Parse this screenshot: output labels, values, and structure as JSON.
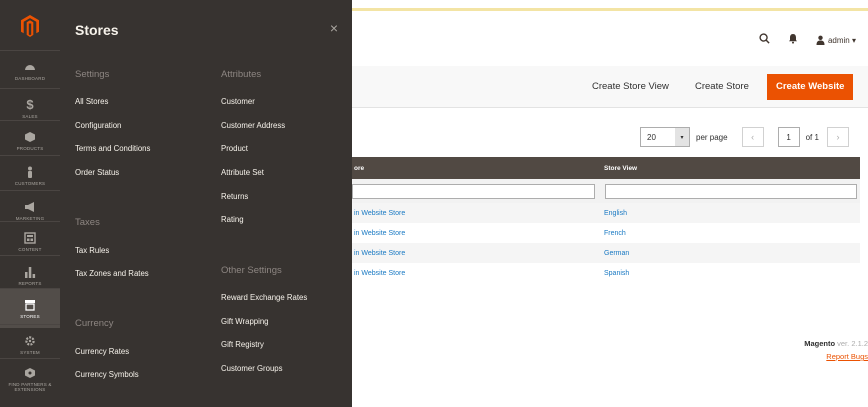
{
  "sidebar": {
    "items": [
      {
        "label": "DASHBOARD",
        "icon": "dashboard-icon"
      },
      {
        "label": "SALES",
        "icon": "dollar-icon"
      },
      {
        "label": "PRODUCTS",
        "icon": "cube-icon"
      },
      {
        "label": "CUSTOMERS",
        "icon": "person-icon"
      },
      {
        "label": "MARKETING",
        "icon": "megaphone-icon"
      },
      {
        "label": "CONTENT",
        "icon": "layout-icon"
      },
      {
        "label": "REPORTS",
        "icon": "bar-chart-icon"
      },
      {
        "label": "STORES",
        "icon": "store-icon"
      },
      {
        "label": "SYSTEM",
        "icon": "gear-icon"
      },
      {
        "label": "FIND PARTNERS & EXTENSIONS",
        "icon": "partners-icon"
      }
    ]
  },
  "flyout": {
    "title": "Stores",
    "close": "×",
    "col1": {
      "settings_title": "Settings",
      "settings": [
        "All Stores",
        "Configuration",
        "Terms and Conditions",
        "Order Status"
      ],
      "taxes_title": "Taxes",
      "taxes": [
        "Tax Rules",
        "Tax Zones and Rates"
      ],
      "currency_title": "Currency",
      "currency": [
        "Currency Rates",
        "Currency Symbols"
      ]
    },
    "col2": {
      "attributes_title": "Attributes",
      "attributes": [
        "Customer",
        "Customer Address",
        "Product",
        "Attribute Set",
        "Returns",
        "Rating"
      ],
      "other_title": "Other Settings",
      "other": [
        "Reward Exchange Rates",
        "Gift Wrapping",
        "Gift Registry",
        "Customer Groups"
      ]
    }
  },
  "header": {
    "admin_label": "admin ▾"
  },
  "actions": {
    "create_store_view": "Create Store View",
    "create_store": "Create Store",
    "create_website": "Create Website"
  },
  "pager": {
    "page_size": "20",
    "per_page": "per page",
    "prev": "‹",
    "page": "1",
    "of": "of 1",
    "next": "›"
  },
  "grid": {
    "columns": [
      "ore",
      "Store View"
    ],
    "rows": [
      [
        "in Website Store",
        "English"
      ],
      [
        "in Website Store",
        "French"
      ],
      [
        "in Website Store",
        "German"
      ],
      [
        "in Website Store",
        "Spanish"
      ]
    ]
  },
  "footer": {
    "brand": "Magento",
    "version": "ver. 2.1.2",
    "report_bugs": "Report Bugs"
  },
  "colors": {
    "sidebar_bg": "#373330",
    "accent": "#eb5202",
    "link": "#1979c3",
    "grid_header": "#514943"
  }
}
